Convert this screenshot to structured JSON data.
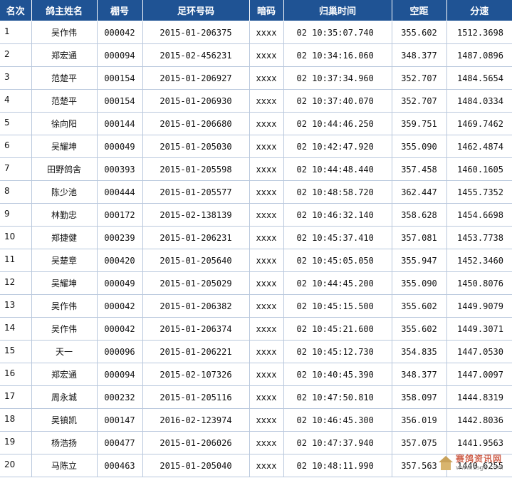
{
  "table": {
    "headers": [
      "名次",
      "鸽主姓名",
      "棚号",
      "足环号码",
      "暗码",
      "归巢时间",
      "空距",
      "分速"
    ],
    "rows": [
      [
        "1",
        "吴作伟",
        "000042",
        "2015-01-206375",
        "xxxx",
        "02 10:35:07.740",
        "355.602",
        "1512.3698"
      ],
      [
        "2",
        "郑宏通",
        "000094",
        "2015-02-456231",
        "xxxx",
        "02 10:34:16.060",
        "348.377",
        "1487.0896"
      ],
      [
        "3",
        "范楚平",
        "000154",
        "2015-01-206927",
        "xxxx",
        "02 10:37:34.960",
        "352.707",
        "1484.5654"
      ],
      [
        "4",
        "范楚平",
        "000154",
        "2015-01-206930",
        "xxxx",
        "02 10:37:40.070",
        "352.707",
        "1484.0334"
      ],
      [
        "5",
        "徐向阳",
        "000144",
        "2015-01-206680",
        "xxxx",
        "02 10:44:46.250",
        "359.751",
        "1469.7462"
      ],
      [
        "6",
        "吴耀坤",
        "000049",
        "2015-01-205030",
        "xxxx",
        "02 10:42:47.920",
        "355.090",
        "1462.4874"
      ],
      [
        "7",
        "田野鸽舍",
        "000393",
        "2015-01-205598",
        "xxxx",
        "02 10:44:48.440",
        "357.458",
        "1460.1605"
      ],
      [
        "8",
        "陈少池",
        "000444",
        "2015-01-205577",
        "xxxx",
        "02 10:48:58.720",
        "362.447",
        "1455.7352"
      ],
      [
        "9",
        "林勤忠",
        "000172",
        "2015-02-138139",
        "xxxx",
        "02 10:46:32.140",
        "358.628",
        "1454.6698"
      ],
      [
        "10",
        "郑捷健",
        "000239",
        "2015-01-206231",
        "xxxx",
        "02 10:45:37.410",
        "357.081",
        "1453.7738"
      ],
      [
        "11",
        "吴楚章",
        "000420",
        "2015-01-205640",
        "xxxx",
        "02 10:45:05.050",
        "355.947",
        "1452.3460"
      ],
      [
        "12",
        "吴耀坤",
        "000049",
        "2015-01-205029",
        "xxxx",
        "02 10:44:45.200",
        "355.090",
        "1450.8076"
      ],
      [
        "13",
        "吴作伟",
        "000042",
        "2015-01-206382",
        "xxxx",
        "02 10:45:15.500",
        "355.602",
        "1449.9079"
      ],
      [
        "14",
        "吴作伟",
        "000042",
        "2015-01-206374",
        "xxxx",
        "02 10:45:21.600",
        "355.602",
        "1449.3071"
      ],
      [
        "15",
        "天一",
        "000096",
        "2015-01-206221",
        "xxxx",
        "02 10:45:12.730",
        "354.835",
        "1447.0530"
      ],
      [
        "16",
        "郑宏通",
        "000094",
        "2015-02-107326",
        "xxxx",
        "02 10:40:45.390",
        "348.377",
        "1447.0097"
      ],
      [
        "17",
        "周永城",
        "000232",
        "2015-01-205116",
        "xxxx",
        "02 10:47:50.810",
        "358.097",
        "1444.8319"
      ],
      [
        "18",
        "吴镇凯",
        "000147",
        "2016-02-123974",
        "xxxx",
        "02 10:46:45.300",
        "356.019",
        "1442.8036"
      ],
      [
        "19",
        "杨浩扬",
        "000477",
        "2015-01-206026",
        "xxxx",
        "02 10:47:37.940",
        "357.075",
        "1441.9563"
      ],
      [
        "20",
        "马陈立",
        "000463",
        "2015-01-205040",
        "xxxx",
        "02 10:48:11.990",
        "357.563",
        "1440.6255"
      ]
    ]
  },
  "watermark": {
    "name": "赛鸽资讯网",
    "url": "www.ssge.com"
  },
  "colors": {
    "header_bg": "#1f5394",
    "header_text": "#ffffff",
    "grid_line": "#b9c8dd"
  }
}
